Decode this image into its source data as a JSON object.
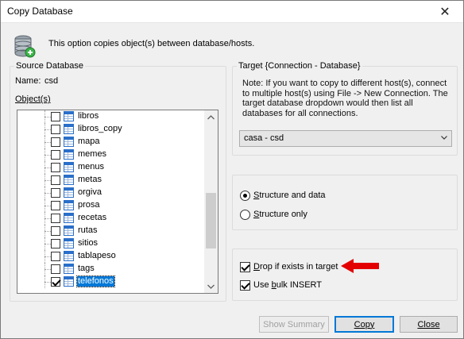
{
  "window": {
    "title": "Copy Database",
    "close_glyph": "✕"
  },
  "info": {
    "text": "This option copies object(s) between database/hosts.",
    "icon": "database-icon"
  },
  "source": {
    "group_label": "Source Database",
    "name_label": "Name:",
    "name_value": "csd",
    "objects_label": "Object(s)",
    "objects": [
      {
        "label": "libros",
        "checked": false
      },
      {
        "label": "libros_copy",
        "checked": false
      },
      {
        "label": "mapa",
        "checked": false
      },
      {
        "label": "memes",
        "checked": false
      },
      {
        "label": "menus",
        "checked": false
      },
      {
        "label": "metas",
        "checked": false
      },
      {
        "label": "orgiva",
        "checked": false
      },
      {
        "label": "prosa",
        "checked": false
      },
      {
        "label": "recetas",
        "checked": false
      },
      {
        "label": "rutas",
        "checked": false
      },
      {
        "label": "sitios",
        "checked": false
      },
      {
        "label": "tablapeso",
        "checked": false
      },
      {
        "label": "tags",
        "checked": false
      },
      {
        "label": "telefonos",
        "checked": true,
        "selected": true
      }
    ]
  },
  "target": {
    "group_label": "Target {Connection - Database}",
    "note": "Note: If you want to copy to different host(s), connect to multiple host(s) using  File -> New Connection. The target database dropdown would then list all databases for all connections.",
    "selected_db": "casa - csd"
  },
  "options": {
    "structure_and_data": {
      "label": "Structure and data",
      "selected": true
    },
    "structure_only": {
      "label": "Structure only",
      "selected": false
    },
    "drop_if_exists": {
      "label": "Drop if exists in target",
      "checked": true
    },
    "use_bulk_insert": {
      "label": "Use bulk INSERT",
      "checked": true
    }
  },
  "buttons": {
    "show_summary": "Show Summary",
    "copy": "Copy",
    "close": "Close"
  },
  "colors": {
    "accent": "#0078d7",
    "annotation_arrow": "#e30000"
  }
}
